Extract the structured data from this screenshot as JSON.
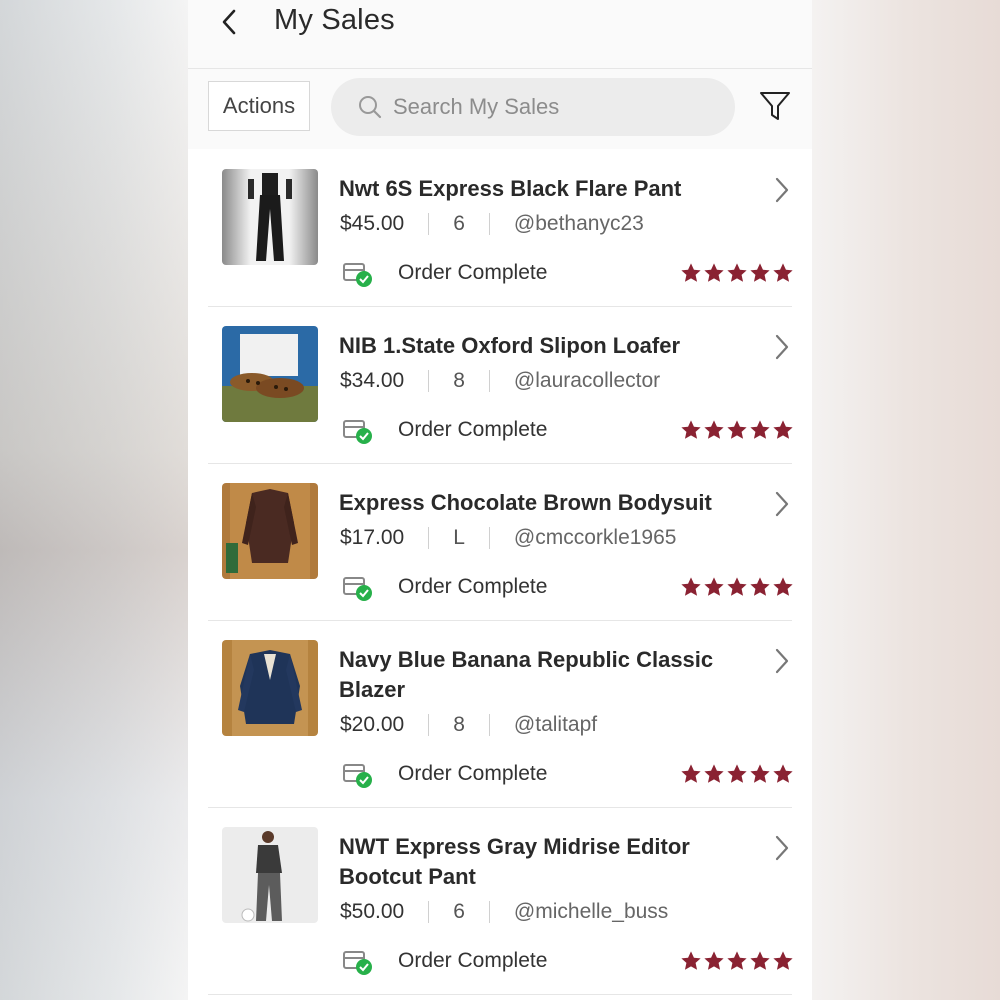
{
  "header": {
    "title": "My Sales"
  },
  "toolbar": {
    "actions_label": "Actions",
    "search_placeholder": "Search My Sales"
  },
  "colors": {
    "star": "#8a2232",
    "check": "#27b04a"
  },
  "icons": {
    "back": "chevron-left-icon",
    "search": "search-icon",
    "filter": "filter-icon",
    "chevron": "chevron-right-icon",
    "status": "order-complete-icon",
    "star": "star-icon"
  },
  "sales": [
    {
      "title": "Nwt 6S Express Black Flare Pant",
      "price": "$45.00",
      "size": "6",
      "buyer": "@bethanyc23",
      "status": "Order Complete",
      "rating": 5
    },
    {
      "title": "NIB 1.State Oxford Slipon Loafer",
      "price": "$34.00",
      "size": "8",
      "buyer": "@lauracollector",
      "status": "Order Complete",
      "rating": 5
    },
    {
      "title": "Express Chocolate Brown Bodysuit",
      "price": "$17.00",
      "size": "L",
      "buyer": "@cmccorkle1965",
      "status": "Order Complete",
      "rating": 5
    },
    {
      "title": "Navy Blue Banana Republic Classic Blazer",
      "price": "$20.00",
      "size": "8",
      "buyer": "@talitapf",
      "status": "Order Complete",
      "rating": 5
    },
    {
      "title": "NWT Express Gray Midrise Editor Bootcut Pant",
      "price": "$50.00",
      "size": "6",
      "buyer": "@michelle_buss",
      "status": "Order Complete",
      "rating": 5
    }
  ]
}
